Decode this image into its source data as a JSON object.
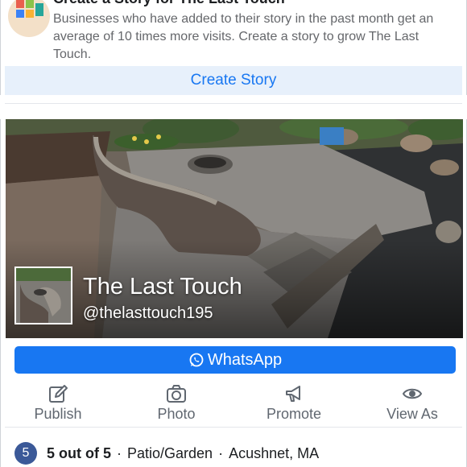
{
  "story": {
    "title": "Create a Story for The Last Touch",
    "description": "Businesses who have added to their story in the past month get an average of 10 times more visits. Create a story to grow The Last Touch.",
    "button_label": "Create Story"
  },
  "page": {
    "name": "The Last Touch",
    "handle": "@thelasttouch195"
  },
  "whatsapp": {
    "label": "WhatsApp",
    "icon": "whatsapp-icon",
    "color": "#1877f2"
  },
  "actions": [
    {
      "label": "Publish",
      "icon": "edit-icon"
    },
    {
      "label": "Photo",
      "icon": "camera-icon"
    },
    {
      "label": "Promote",
      "icon": "megaphone-icon"
    },
    {
      "label": "View As",
      "icon": "eye-icon"
    }
  ],
  "rating": {
    "badge": "5",
    "score": "5 out of 5",
    "category": "Patio/Garden",
    "location": "Acushnet, MA"
  },
  "colors": {
    "accent": "#1877f2",
    "create_story_bg": "#e7f0fb",
    "rating_badge": "#3b5998"
  }
}
